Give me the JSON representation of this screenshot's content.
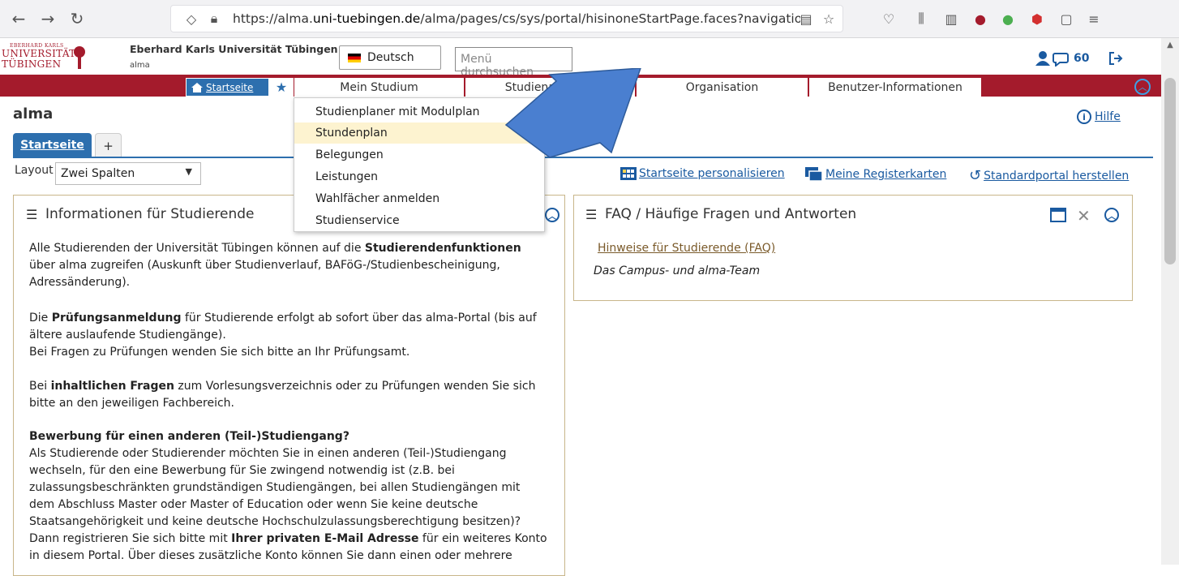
{
  "browser": {
    "url_prefix": "https://alma.",
    "url_domain": "uni-tuebingen.de",
    "url_rest": "/alma/pages/cs/sys/portal/hisinoneStartPage.faces?navigationPositio"
  },
  "header": {
    "logo_small": "EBERHARD KARLS",
    "logo_line1": "UNIVERSITÄT",
    "logo_line2": "TÜBINGEN",
    "institution": "Eberhard Karls Universität Tübingen",
    "app_name": "alma",
    "language": "Deutsch",
    "menu_search_placeholder": "Menü durchsuchen",
    "message_count": "60"
  },
  "nav": {
    "start": "Startseite",
    "items": [
      "Mein Studium",
      "Studienangebot",
      "Organisation",
      "Benutzer-Informationen"
    ]
  },
  "dropdown": {
    "items": [
      "Studienplaner mit Modulplan",
      "Stundenplan",
      "Belegungen",
      "Leistungen",
      "Wahlfächer anmelden",
      "Studienservice"
    ],
    "highlighted": "Stundenplan"
  },
  "page": {
    "title": "alma",
    "help": "Hilfe",
    "tab_active": "Startseite",
    "tab_add": "+",
    "layout_label": "Layout",
    "layout_value": "Zwei Spalten",
    "personalize": "Startseite personalisieren",
    "my_tabs": "Meine Registerkarten",
    "reset": "Standardportal herstellen"
  },
  "info_panel": {
    "title": "Informationen für Studierende",
    "p1_a": "Alle Studierenden der Universität Tübingen können auf die ",
    "p1_b": "Studierendenfunktionen",
    "p1_c": "über alma zugreifen (Auskunft über Studienverlauf, BAFöG-/Studienbescheinigung,",
    "p1_d": "Adressänderung).",
    "p2_a": "Die ",
    "p2_b": "Prüfungsanmeldung",
    "p2_c": " für Studierende erfolgt ab sofort über das alma-Portal (bis auf",
    "p2_d": "ältere auslaufende Studiengänge).",
    "p2_e": "Bei Fragen zu Prüfungen wenden Sie sich bitte an Ihr Prüfungsamt.",
    "p3_a": "Bei ",
    "p3_b": "inhaltlichen Fragen",
    "p3_c": " zum Vorlesungsverzeichnis oder zu Prüfungen wenden Sie sich",
    "p3_d": "bitte an den jeweiligen Fachbereich.",
    "p4_head": "Bewerbung für einen anderen (Teil-)Studiengang?",
    "p4_l1": "Als Studierende oder Studierender möchten Sie in einen anderen (Teil-)Studiengang",
    "p4_l2": "wechseln, für den eine Bewerbung für Sie zwingend notwendig ist (z.B. bei",
    "p4_l3": "zulassungsbeschränkten grundständigen Studiengängen, bei allen Studiengängen mit",
    "p4_l4": "dem Abschluss Master oder Master of Education oder wenn Sie keine deutsche",
    "p4_l5": "Staatsangehörigkeit und keine deutsche Hochschulzulassungsberechtigung besitzen)?",
    "p4_l6a": "Dann registrieren Sie sich bitte mit ",
    "p4_l6b": "Ihrer privaten E-Mail Adresse",
    "p4_l6c": " für ein weiteres Konto",
    "p4_l7": "in diesem Portal. Über dieses zusätzliche Konto können Sie dann einen oder mehrere"
  },
  "faq_panel": {
    "title": "FAQ / Häufige Fragen und Antworten",
    "link": "Hinweise für Studierende (FAQ)",
    "team": "Das Campus- und alma-Team"
  },
  "colors": {
    "brand_red": "#a41b2c",
    "primary_blue": "#2d6fae",
    "arrow_blue": "#4a7fd0"
  }
}
